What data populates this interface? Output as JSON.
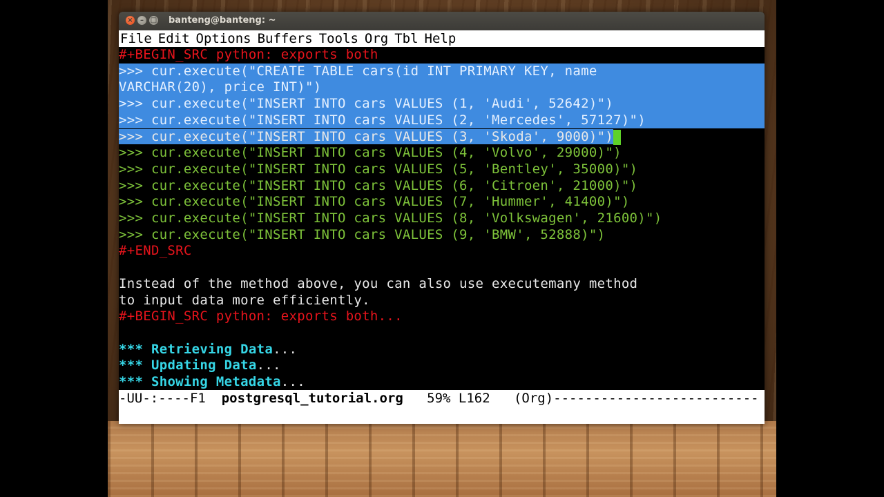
{
  "window": {
    "title": "banteng@banteng: ~",
    "close_glyph": "×",
    "min_glyph": "–",
    "max_glyph": "□"
  },
  "menu": [
    "File",
    "Edit",
    "Options",
    "Buffers",
    "Tools",
    "Org",
    "Tbl",
    "Help"
  ],
  "buffer": {
    "begin_src_1": "#+BEGIN_SRC python: exports both",
    "sel_line_1": ">>> cur.execute(\"CREATE TABLE cars(id INT PRIMARY KEY, name",
    "sel_line_2": "VARCHAR(20), price INT)\")",
    "sel_line_3": ">>> cur.execute(\"INSERT INTO cars VALUES (1, 'Audi', 52642)\")",
    "sel_line_4": ">>> cur.execute(\"INSERT INTO cars VALUES (2, 'Mercedes', 57127)\")",
    "sel_line_5": ">>> cur.execute(\"INSERT INTO cars VALUES (3, 'Skoda', 9000)\")",
    "code_lines": [
      ">>> cur.execute(\"INSERT INTO cars VALUES (4, 'Volvo', 29000)\")",
      ">>> cur.execute(\"INSERT INTO cars VALUES (5, 'Bentley', 35000)\")",
      ">>> cur.execute(\"INSERT INTO cars VALUES (6, 'Citroen', 21000)\")",
      ">>> cur.execute(\"INSERT INTO cars VALUES (7, 'Hummer', 41400)\")",
      ">>> cur.execute(\"INSERT INTO cars VALUES (8, 'Volkswagen', 21600)\")",
      ">>> cur.execute(\"INSERT INTO cars VALUES (9, 'BMW', 52888)\")"
    ],
    "end_src": "#+END_SRC",
    "para_1": "Instead of the method above, you can also use executemany method",
    "para_2": "to input data more efficiently.",
    "begin_src_2": "#+BEGIN_SRC python: exports both...",
    "headings": [
      {
        "stars": "***",
        "title": "Retrieving Data",
        "ellipsis": "..."
      },
      {
        "stars": "***",
        "title": "Updating Data",
        "ellipsis": "..."
      },
      {
        "stars": "***",
        "title": "Showing Metadata",
        "ellipsis": "..."
      }
    ]
  },
  "modeline": {
    "prefix": "-UU-:----F1  ",
    "buffer_name": "postgresql_tutorial.org",
    "suffix": "   59% L162   (Org)--------------------------"
  },
  "colors": {
    "selection": "#3f8be0",
    "keyword_red": "#e8141c",
    "code_green": "#7ec33a",
    "heading_cyan": "#36d6e6",
    "cursor": "#5ed228"
  }
}
